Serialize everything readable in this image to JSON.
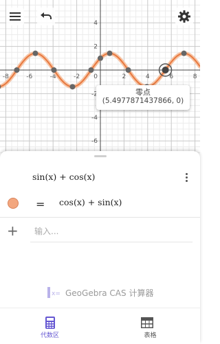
{
  "graph": {
    "x_ticks": [
      "-8",
      "-6",
      "-4",
      "-2",
      "2",
      "4",
      "6",
      "8"
    ],
    "y_ticks": [
      "4",
      "2",
      "-2",
      "-4",
      "-6"
    ],
    "axis_zero": "0",
    "curve_color": "#e8793f",
    "point_color": "#666666",
    "tooltip": {
      "title": "零点",
      "value": "(5.4977871437866, 0)"
    }
  },
  "toolbar": {
    "menu_icon": "menu-icon",
    "undo_icon": "undo-icon",
    "settings_icon": "gear-icon"
  },
  "algebra": {
    "input_expr": "sin(x) + cos(x)",
    "eq_symbol": "=",
    "output_expr": "cos(x) + sin(x)",
    "new_input_placeholder": "输入...",
    "brand_text": "GeoGebra CAS 计算器",
    "dot_color": "#f3a77f"
  },
  "bottom_nav": {
    "algebra_label": "代数区",
    "table_label": "表格",
    "active_color": "#6557d2"
  }
}
